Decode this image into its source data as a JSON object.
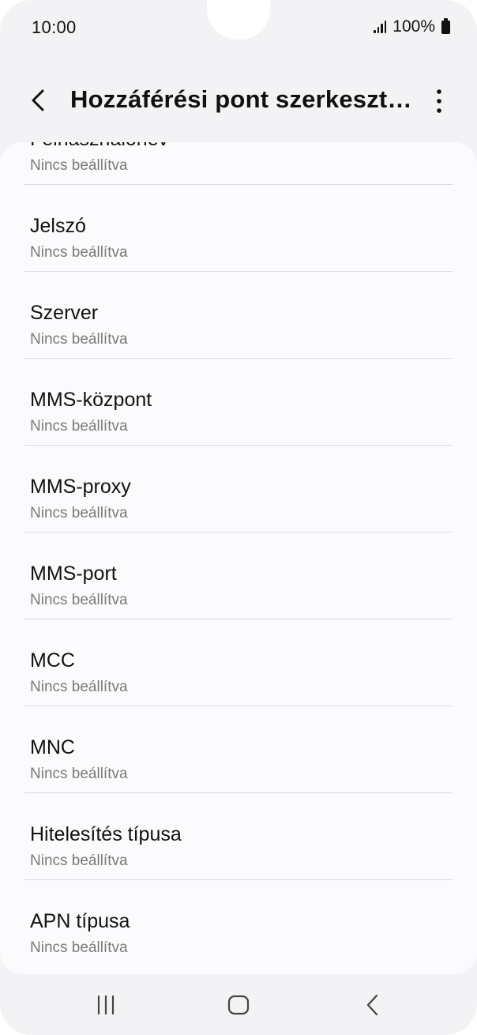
{
  "status_bar": {
    "time": "10:00",
    "battery": "100%",
    "icons": [
      "signal-icon",
      "battery-icon"
    ]
  },
  "header": {
    "title": "Hozzáférési pont szerkesztése",
    "back_icon": "back-arrow-icon",
    "more_icon": "more-options-icon"
  },
  "settings": {
    "items": [
      {
        "label": "Felhasználónév",
        "value": "Nincs beállítva"
      },
      {
        "label": "Jelszó",
        "value": "Nincs beállítva"
      },
      {
        "label": "Szerver",
        "value": "Nincs beállítva"
      },
      {
        "label": "MMS-központ",
        "value": "Nincs beállítva"
      },
      {
        "label": "MMS-proxy",
        "value": "Nincs beállítva"
      },
      {
        "label": "MMS-port",
        "value": "Nincs beállítva"
      },
      {
        "label": "MCC",
        "value": "Nincs beállítva"
      },
      {
        "label": "MNC",
        "value": "Nincs beállítva"
      },
      {
        "label": "Hitelesítés típusa",
        "value": "Nincs beállítva"
      },
      {
        "label": "APN típusa",
        "value": "Nincs beállítva"
      }
    ]
  },
  "nav_bar": {
    "icons": [
      "recent-apps-icon",
      "home-icon",
      "back-icon"
    ]
  }
}
